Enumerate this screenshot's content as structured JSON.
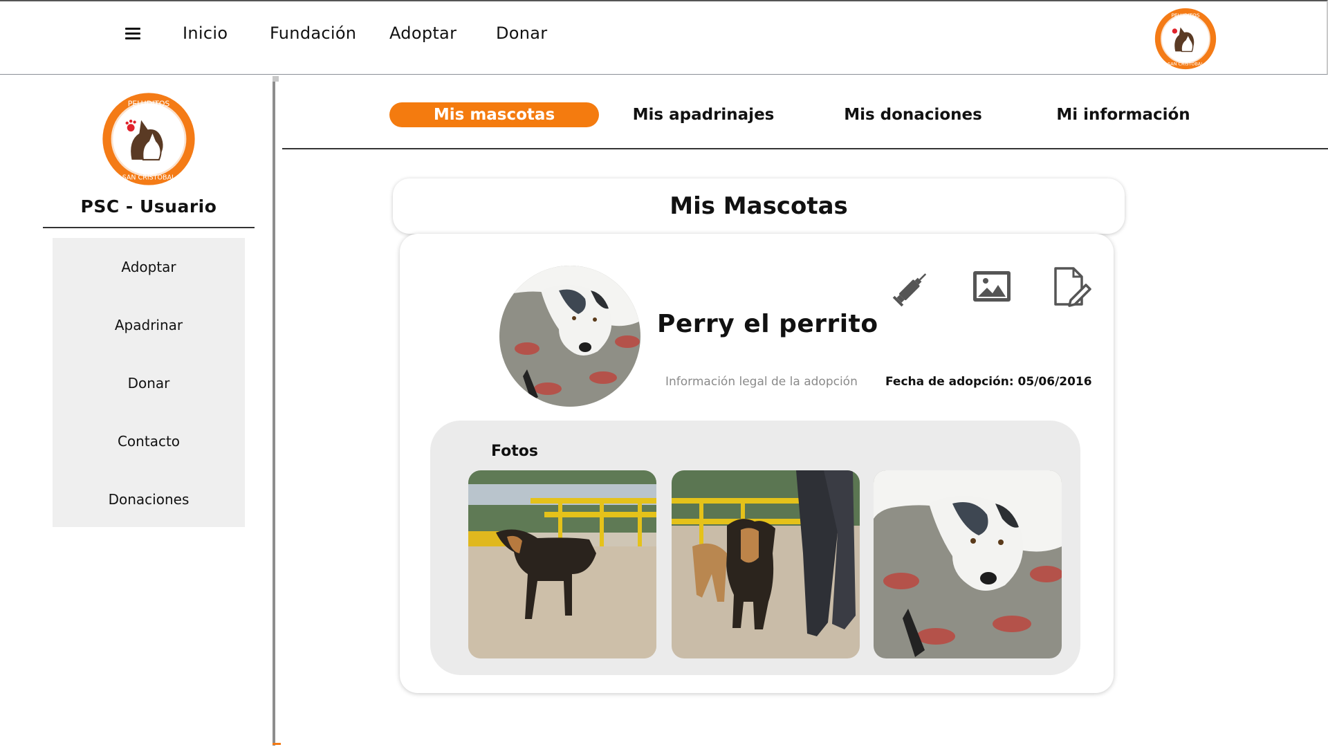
{
  "topnav": {
    "items": [
      "Inicio",
      "Fundación",
      "Adoptar",
      "Donar"
    ]
  },
  "brand": {
    "logo_text_top": "PELUDITOS",
    "logo_text_bottom": "SAN CRISTOBAL",
    "accent_color": "#f47b0f"
  },
  "sidebar": {
    "title": "PSC - Usuario",
    "items": [
      "Adoptar",
      "Apadrinar",
      "Donar",
      "Contacto",
      "Donaciones"
    ]
  },
  "tabs": [
    {
      "label": "Mis mascotas",
      "active": true
    },
    {
      "label": "Mis apadrinajes",
      "active": false
    },
    {
      "label": "Mis donaciones",
      "active": false
    },
    {
      "label": "Mi información",
      "active": false
    }
  ],
  "main": {
    "title": "Mis Mascotas",
    "pet": {
      "name": "Perry el perrito",
      "legal_link": "Información legal de la adopción",
      "adoption_label": "Fecha de adopción:",
      "adoption_date": "05/06/2016"
    },
    "actions": [
      "syringe-icon",
      "image-icon",
      "edit-document-icon"
    ],
    "photos_label": "Fotos"
  }
}
